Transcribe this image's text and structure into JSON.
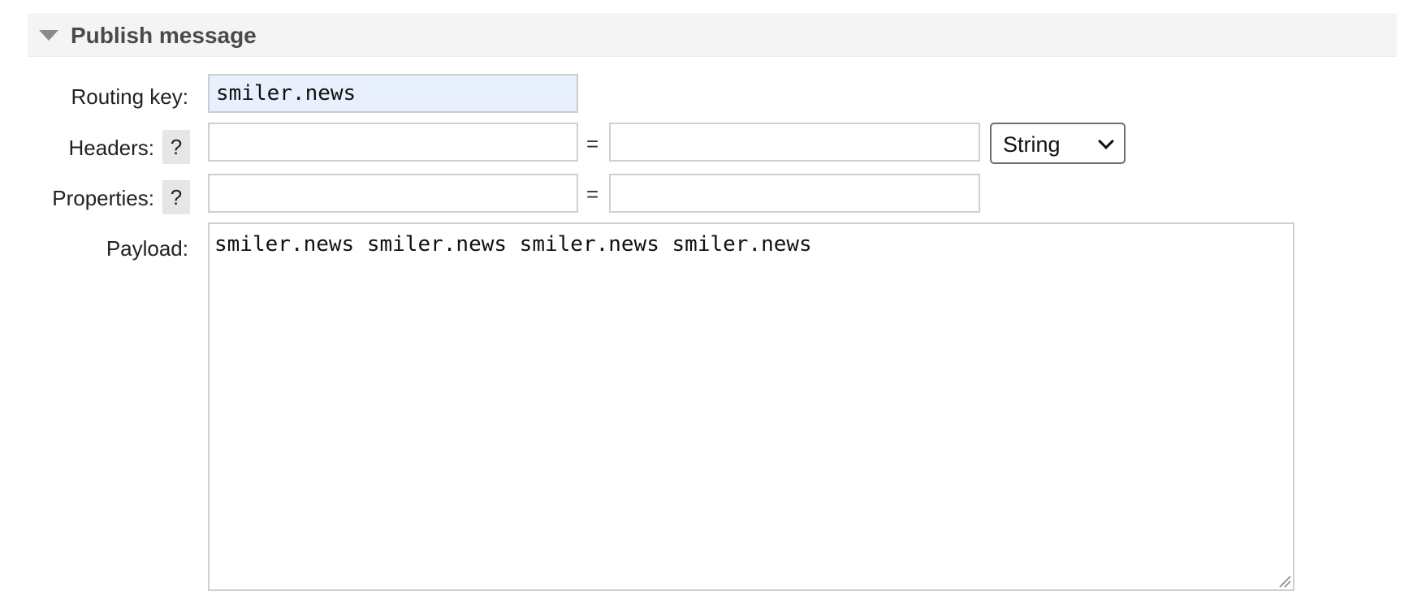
{
  "section": {
    "title": "Publish message",
    "toggle_icon": "triangle-down-icon"
  },
  "routing_key": {
    "label": "Routing key:",
    "value": "smiler.news"
  },
  "headers": {
    "label": "Headers:",
    "help": "?",
    "key_value": "",
    "separator": "=",
    "value_value": "",
    "type_selected": "String",
    "type_icon": "chevron-down-icon"
  },
  "properties": {
    "label": "Properties:",
    "help": "?",
    "key_value": "",
    "separator": "=",
    "value_value": ""
  },
  "payload": {
    "label": "Payload:",
    "value": "smiler.news smiler.news smiler.news smiler.news"
  },
  "colors": {
    "header_bg": "#f4f4f4",
    "filled_input_bg": "#e8effd",
    "help_bg": "#e6e6e6",
    "input_border": "#cfcfcf"
  }
}
